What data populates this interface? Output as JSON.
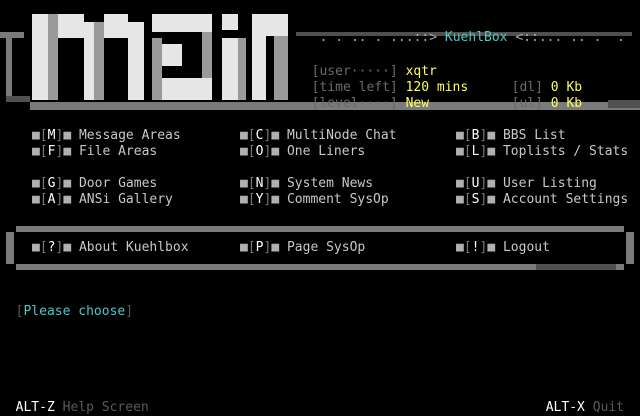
{
  "header": {
    "title_prefix": ". . .. . ...::>",
    "title": "KuehlBox",
    "title_suffix": "<::... .. .  .",
    "logo_text": "main"
  },
  "stats": {
    "user_label": "[user·····]",
    "user_value": "xqtr",
    "time_label": "[time left]",
    "time_value": "120 mins",
    "level_label": "[level····]",
    "level_value": "New",
    "dl_label": "[dl]",
    "dl_value": "0 Kb",
    "ul_label": "[ul]",
    "ul_value": "0 Kb"
  },
  "menu": {
    "col1": [
      {
        "key": "M",
        "label": "Message Areas"
      },
      {
        "key": "F",
        "label": "File Areas"
      },
      {
        "key": "G",
        "label": "Door Games"
      },
      {
        "key": "A",
        "label": "ANSi Gallery"
      }
    ],
    "col2": [
      {
        "key": "C",
        "label": "MultiNode Chat"
      },
      {
        "key": "O",
        "label": "One Liners"
      },
      {
        "key": "N",
        "label": "System News"
      },
      {
        "key": "Y",
        "label": "Comment SysOp"
      }
    ],
    "col3": [
      {
        "key": "B",
        "label": "BBS List"
      },
      {
        "key": "L",
        "label": "Toplists / Stats"
      },
      {
        "key": "U",
        "label": "User Listing"
      },
      {
        "key": "S",
        "label": "Account Settings"
      }
    ],
    "bottom": [
      {
        "key": "?",
        "label": "About Kuehlbox"
      },
      {
        "key": "P",
        "label": "Page SysOp"
      },
      {
        "key": "!",
        "label": "Logout"
      }
    ]
  },
  "prompt": {
    "open": "[",
    "text": "Please choose",
    "close": "]"
  },
  "footer": {
    "left_key": "ALT-Z",
    "left_label": "Help Screen",
    "right_key": "ALT-X",
    "right_label": "Quit"
  }
}
